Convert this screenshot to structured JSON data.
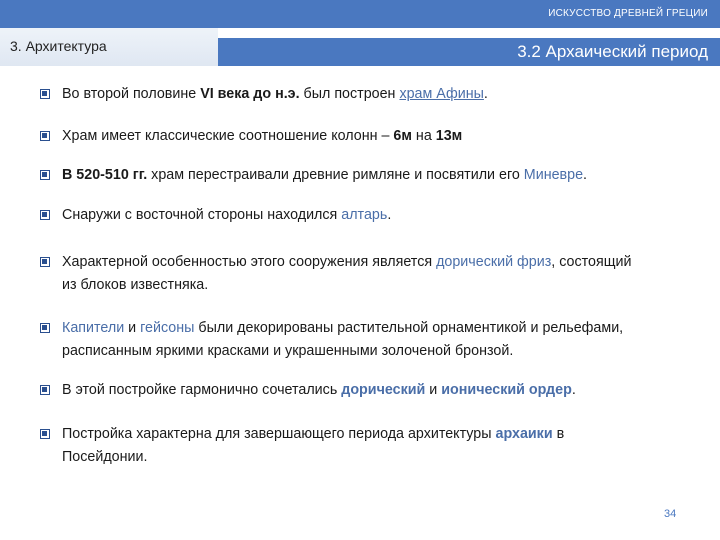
{
  "header": {
    "course": "ИСКУССТВО ДРЕВНЕЙ ГРЕЦИИ",
    "section": "3.  Архитектура",
    "subtitle": "3.2 Архаический период"
  },
  "bullets": [
    [
      "Во второй половине ",
      "VI века до н.э.",
      " был построен ",
      "храм Афины",
      "."
    ],
    [
      "Храм имеет классические соотношение колонн – ",
      "6м",
      " на ",
      "13м",
      ""
    ],
    [
      "В 520-510 гг.",
      " храм перестраивали древние римляне и посвятили его ",
      "Миневре",
      "."
    ],
    [
      "Снаружи с восточной стороны находился ",
      "алтарь",
      "."
    ],
    [
      "Характерной особенностью этого сооружения является ",
      "дорический фриз",
      ", состоящий",
      "из блоков известняка."
    ],
    [
      "Капители",
      " и ",
      "гейсоны",
      " были декорированы растительной орнаментикой и рельефами,",
      "расписанным яркими красками и украшенными золоченой бронзой."
    ],
    [
      "В этой постройке гармонично сочетались ",
      "дорический",
      " и ",
      "ионический ордер",
      "."
    ],
    [
      "Постройка характерна для завершающего периода архитектуры ",
      "архаики",
      " в",
      "Посейдонии."
    ]
  ],
  "page_number": "34"
}
